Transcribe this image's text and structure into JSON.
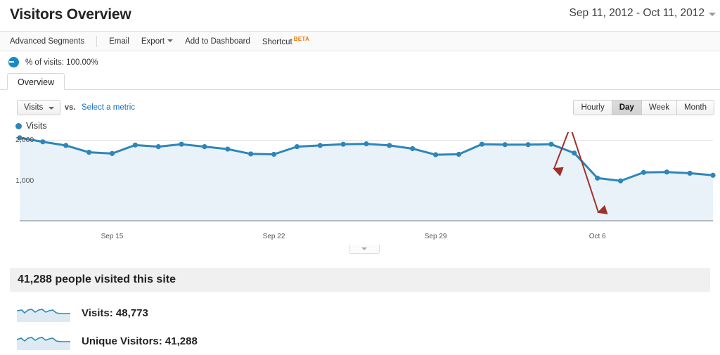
{
  "header": {
    "title": "Visitors Overview",
    "date_range": "Sep 11, 2012 - Oct 11, 2012"
  },
  "toolbar": {
    "advanced_segments": "Advanced Segments",
    "email": "Email",
    "export": "Export",
    "add_to_dashboard": "Add to Dashboard",
    "shortcut": "Shortcut",
    "beta": "BETA"
  },
  "segment": {
    "label": "% of visits: 100.00%"
  },
  "tabs": {
    "overview": "Overview"
  },
  "controls": {
    "metric_selected": "Visits",
    "vs": "vs.",
    "select_metric": "Select a metric",
    "granularity": [
      "Hourly",
      "Day",
      "Week",
      "Month"
    ],
    "granularity_active": "Day"
  },
  "chart_legend": {
    "series_name": "Visits"
  },
  "summary": {
    "headline": "41,288 people visited this site",
    "metrics": [
      {
        "label": "Visits: 48,773",
        "name": "visits"
      },
      {
        "label": "Unique Visitors: 41,288",
        "name": "unique-visitors"
      }
    ]
  },
  "colors": {
    "line": "#2e86b8",
    "fill": "#e8f2f8",
    "annotation": "#a03028",
    "beta": "#e8790c",
    "link": "#1a73c4"
  },
  "chart_data": {
    "type": "line",
    "title": "Visits",
    "xlabel": "",
    "ylabel": "Visits",
    "ylim": [
      0,
      2200
    ],
    "grid": true,
    "legend_position": "top-left",
    "y_ticks": [
      "1,000",
      "2,000"
    ],
    "y_tick_values": [
      1000,
      2000
    ],
    "x_tick_labels": [
      "Sep 15",
      "Sep 22",
      "Sep 29",
      "Oct 6"
    ],
    "x_tick_indices": [
      4,
      11,
      18,
      25
    ],
    "x": [
      "Sep 11",
      "Sep 12",
      "Sep 13",
      "Sep 14",
      "Sep 15",
      "Sep 16",
      "Sep 17",
      "Sep 18",
      "Sep 19",
      "Sep 20",
      "Sep 21",
      "Sep 22",
      "Sep 23",
      "Sep 24",
      "Sep 25",
      "Sep 26",
      "Sep 27",
      "Sep 28",
      "Sep 29",
      "Sep 30",
      "Oct 1",
      "Oct 2",
      "Oct 3",
      "Oct 4",
      "Oct 5",
      "Oct 6",
      "Oct 7",
      "Oct 8",
      "Oct 9",
      "Oct 10",
      "Oct 11"
    ],
    "series": [
      {
        "name": "Visits",
        "values": [
          2060,
          1960,
          1870,
          1700,
          1670,
          1880,
          1840,
          1900,
          1840,
          1780,
          1660,
          1650,
          1840,
          1870,
          1900,
          1910,
          1870,
          1790,
          1640,
          1650,
          1900,
          1890,
          1890,
          1900,
          1680,
          1060,
          990,
          1200,
          1210,
          1180,
          1130
        ]
      }
    ],
    "annotations": [
      {
        "type": "arrow",
        "name": "drop-start-arrow",
        "from_x": "Oct 4",
        "to_x": "Oct 5",
        "color": "#a03028"
      },
      {
        "type": "arrow",
        "name": "drop-end-arrow",
        "from_x": "Oct 4",
        "to_x": "Oct 6",
        "color": "#a03028"
      }
    ]
  }
}
